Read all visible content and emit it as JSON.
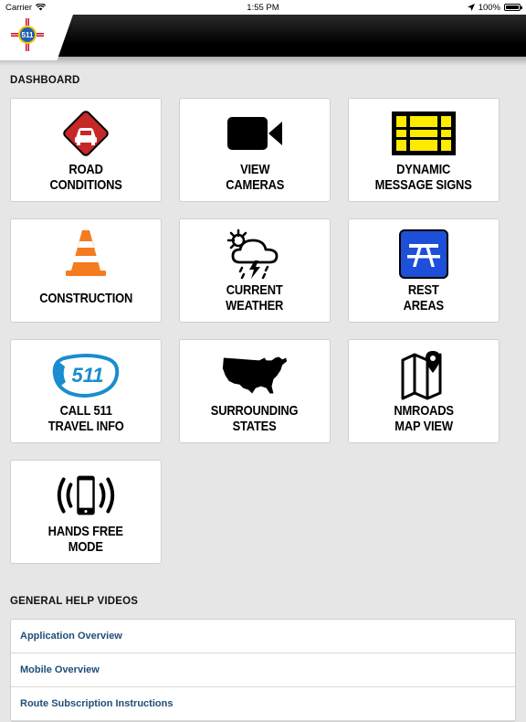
{
  "status_bar": {
    "carrier": "Carrier",
    "time": "1:55 PM",
    "battery": "100%",
    "battery_level": 1.0
  },
  "header": {
    "logo_icon": "nm-511-logo-icon",
    "colors": {
      "bar": "#000000",
      "logo_red": "#c8102e",
      "logo_yellow": "#f2c500",
      "logo_blue": "#1f5fb4"
    }
  },
  "dashboard": {
    "title": "DASHBOARD",
    "tiles": [
      {
        "label": "ROAD\nCONDITIONS",
        "icon": "road-conditions-icon"
      },
      {
        "label": "VIEW\nCAMERAS",
        "icon": "video-camera-icon"
      },
      {
        "label": "DYNAMIC\nMESSAGE SIGNS",
        "icon": "message-sign-icon"
      },
      {
        "label": "CONSTRUCTION",
        "icon": "traffic-cone-icon"
      },
      {
        "label": "CURRENT\nWEATHER",
        "icon": "weather-storm-icon"
      },
      {
        "label": "REST\nAREAS",
        "icon": "picnic-table-icon"
      },
      {
        "label": "CALL 511\nTRAVEL INFO",
        "icon": "phone-511-icon"
      },
      {
        "label": "SURROUNDING\nSTATES",
        "icon": "usa-map-icon"
      },
      {
        "label": "NMROADS\nMAP VIEW",
        "icon": "map-pin-icon"
      },
      {
        "label": "HANDS FREE\nMODE",
        "icon": "hands-free-phone-icon"
      }
    ],
    "icon_text_511": "511",
    "colors": {
      "road_red": "#c62828",
      "cone_orange": "#f47b20",
      "sign_yellow": "#ffeb00",
      "rest_blue": "#1e4fd8",
      "call_blue": "#1a8ccf"
    }
  },
  "help_videos": {
    "title": "GENERAL HELP VIDEOS",
    "items": [
      "Application Overview",
      "Mobile Overview",
      "Route Subscription Instructions"
    ]
  }
}
